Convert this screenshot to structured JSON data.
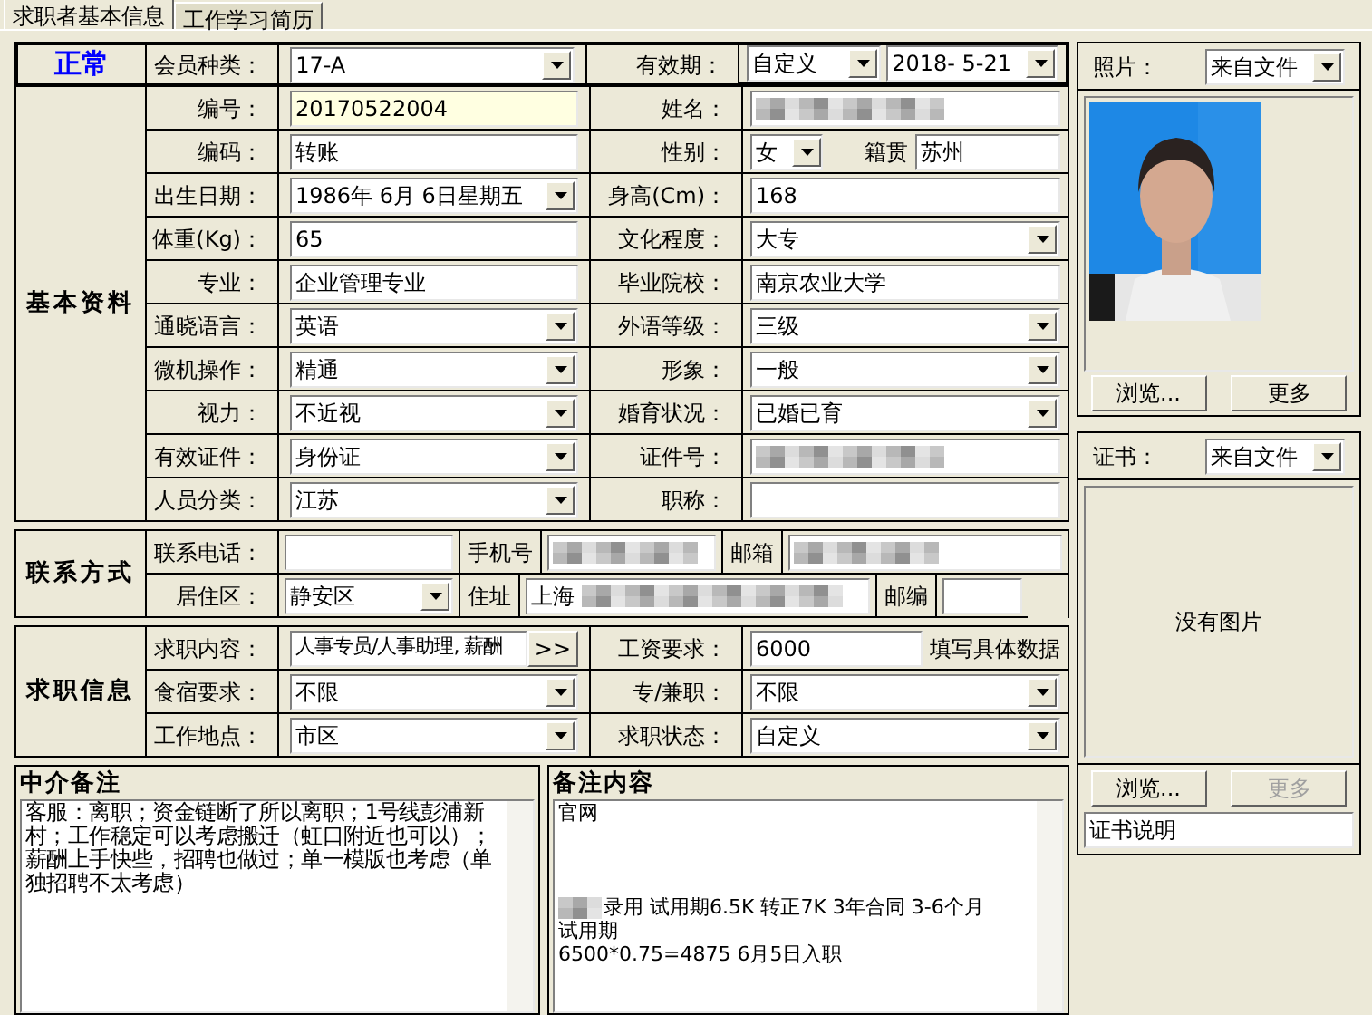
{
  "tabs": [
    {
      "label": "求职者基本信息",
      "selected": true
    },
    {
      "label": "工作学习简历",
      "selected": false
    }
  ],
  "status": "正常",
  "member": {
    "label": "会员种类：",
    "field": {
      "kind": "select",
      "value": "17-A"
    },
    "validity_label": "有效期：",
    "validity_type": {
      "kind": "select",
      "value": "自定义"
    },
    "validity_date": {
      "kind": "select",
      "value": "2018- 5-21"
    }
  },
  "basic": {
    "title": "基本资料",
    "rows": [
      [
        {
          "label": "编号：",
          "kind": "text",
          "value": "20170522004",
          "highlighted": true
        },
        {
          "label": "姓名：",
          "kind": "text",
          "blurred": true
        }
      ],
      [
        {
          "label": "编码：",
          "kind": "text",
          "value": "转账"
        },
        {
          "label": "性别：",
          "kind": "gender",
          "value": "女",
          "extra_label": "籍贯",
          "extra_value": "苏州"
        }
      ],
      [
        {
          "label": "出生日期：",
          "kind": "select",
          "value": "1986年 6月 6日星期五"
        },
        {
          "label": "身高(Cm)：",
          "kind": "text",
          "value": "168"
        }
      ],
      [
        {
          "label": "体重(Kg)：",
          "kind": "text",
          "value": "65"
        },
        {
          "label": "文化程度：",
          "kind": "select",
          "value": "大专"
        }
      ],
      [
        {
          "label": "专业：",
          "kind": "text",
          "value": "企业管理专业"
        },
        {
          "label": "毕业院校：",
          "kind": "text",
          "value": "南京农业大学"
        }
      ],
      [
        {
          "label": "通晓语言：",
          "kind": "select",
          "value": "英语"
        },
        {
          "label": "外语等级：",
          "kind": "select",
          "value": "三级"
        }
      ],
      [
        {
          "label": "微机操作：",
          "kind": "select",
          "value": "精通"
        },
        {
          "label": "形象：",
          "kind": "select",
          "value": "一般"
        }
      ],
      [
        {
          "label": "视力：",
          "kind": "select",
          "value": "不近视"
        },
        {
          "label": "婚育状况：",
          "kind": "select",
          "value": "已婚已育"
        }
      ],
      [
        {
          "label": "有效证件：",
          "kind": "select",
          "value": "身份证"
        },
        {
          "label": "证件号：",
          "kind": "text",
          "blurred": true
        }
      ],
      [
        {
          "label": "人员分类：",
          "kind": "select",
          "value": "江苏"
        },
        {
          "label": "职称：",
          "kind": "text"
        }
      ]
    ]
  },
  "contact": {
    "title": "联系方式",
    "rows": [
      [
        {
          "label": "联系电话：",
          "kind": "text"
        },
        {
          "label": "手机号",
          "kind": "text",
          "blurred": true
        },
        {
          "label": "邮箱",
          "kind": "text",
          "blurred": true
        }
      ],
      [
        {
          "label": "居住区：",
          "kind": "select",
          "value": "静安区"
        },
        {
          "label": "住址",
          "kind": "text",
          "value": "上海",
          "blurred": true
        },
        {
          "label": "邮编",
          "kind": "text"
        }
      ]
    ]
  },
  "job": {
    "title": "求职信息",
    "rows": [
      [
        {
          "label": "求职内容：",
          "kind": "more",
          "value": "人事专员/人事助理, 薪酬",
          "button": ">>"
        },
        {
          "label": "工资要求：",
          "kind": "text",
          "value": "6000",
          "hint": "填写具体数据"
        }
      ],
      [
        {
          "label": "食宿要求：",
          "kind": "select",
          "value": "不限"
        },
        {
          "label": "专/兼职：",
          "kind": "select",
          "value": "不限"
        }
      ],
      [
        {
          "label": "工作地点：",
          "kind": "select",
          "value": "市区"
        },
        {
          "label": "求职状态：",
          "kind": "select",
          "value": "自定义"
        }
      ]
    ]
  },
  "agent_note": {
    "title": "中介备注",
    "text": "客服：离职；资金链断了所以离职；1号线彭浦新村；工作稳定可以考虑搬迁（虹口附近也可以）；薪酬上手快些，招聘也做过；单一模版也考虑（单独招聘不太考虑）"
  },
  "remark": {
    "title": "备注内容",
    "paragraphs": [
      [
        {
          "text": "官网",
          "blurred": false
        }
      ],
      [
        {
          "text": "录用 试用期6.5K 转正7K 3年合同 3-6个月",
          "blurred": true
        },
        {
          "text": "试用期",
          "blurred": false
        },
        {
          "text": "6500*0.75=4875  6月5日入职",
          "blurred": false
        }
      ]
    ]
  },
  "photo": {
    "label": "照片：",
    "source": "来自文件",
    "buttons": [
      {
        "label": "浏览...",
        "disabled": false
      },
      {
        "label": "更多",
        "disabled": false
      }
    ]
  },
  "certificate": {
    "label": "证书：",
    "source": "来自文件",
    "empty_text": "没有图片",
    "buttons": [
      {
        "label": "浏览...",
        "disabled": false
      },
      {
        "label": "更多",
        "disabled": true
      }
    ],
    "description": "证书说明"
  }
}
